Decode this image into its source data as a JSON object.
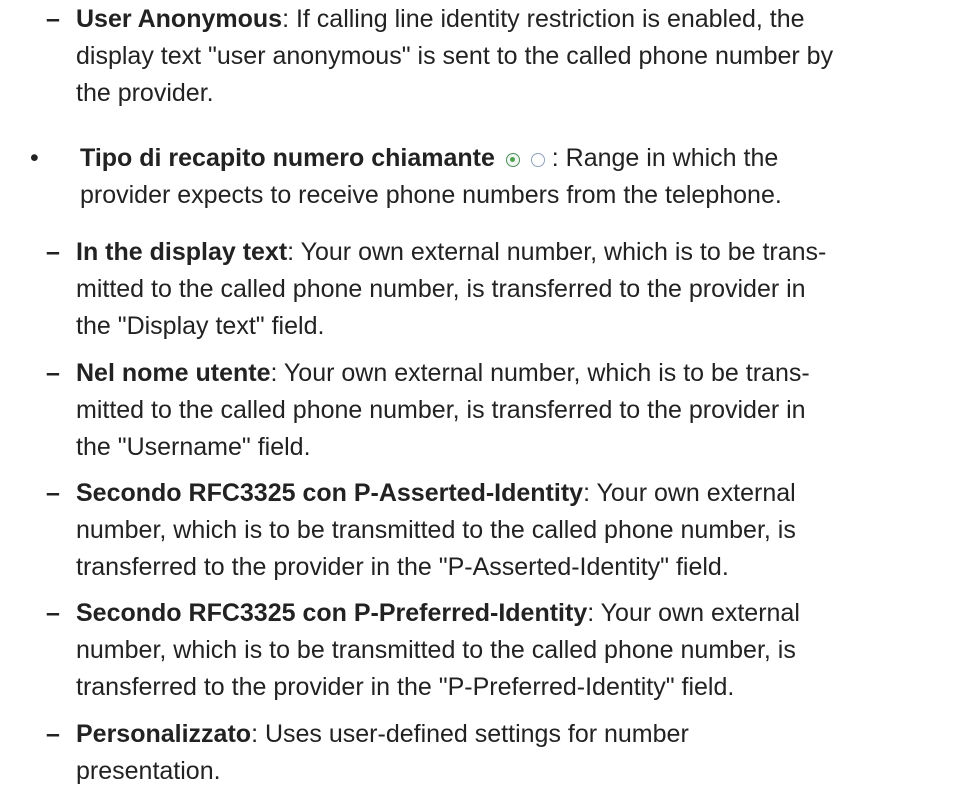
{
  "items": [
    {
      "marker": "–",
      "term": "User Anonymous",
      "lines": [
        ": If calling line identity restriction is enabled, the",
        "display text \"user anonymous\" is sent to the called phone number by",
        "the provider."
      ]
    },
    {
      "marker": "•",
      "term": "Tipo di recapito numero chiamante",
      "radio_icons": [
        "radio-checked-icon",
        "radio-unchecked-icon"
      ],
      "lines": [
        " : Range in which the",
        "provider expects to receive phone numbers from the telephone."
      ]
    },
    {
      "marker": "–",
      "term": "In the display text",
      "lines": [
        ": Your own external number, which is to be trans-",
        "mitted to the called phone number, is transferred to the provider in",
        "the \"Display text\" field."
      ]
    },
    {
      "marker": "–",
      "term": "Nel nome utente",
      "lines": [
        ": Your own external number, which is to be trans-",
        "mitted to the called phone number, is transferred to the provider in",
        "the \"Username\" field."
      ]
    },
    {
      "marker": "–",
      "term": "Secondo RFC3325 con P-Asserted-Identity",
      "lines": [
        ": Your own external",
        "number, which is to be transmitted to the called phone number, is",
        "transferred to the provider in the \"P-Asserted-Identity\" field."
      ]
    },
    {
      "marker": "–",
      "term": "Secondo RFC3325 con P-Preferred-Identity",
      "lines": [
        ": Your own external",
        "number, which is to be transmitted to the called phone number, is",
        "transferred to the provider in the \"P-Preferred-Identity\" field."
      ]
    },
    {
      "marker": "–",
      "term": "Personalizzato",
      "lines": [
        ": Uses user-defined settings for number",
        "presentation."
      ]
    }
  ]
}
